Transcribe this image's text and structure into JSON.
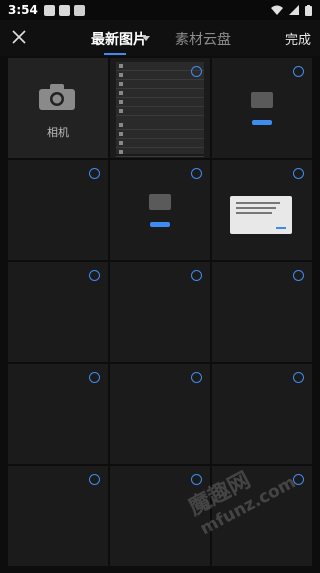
{
  "status_bar": {
    "time": "3:54"
  },
  "header": {
    "close_icon": "close-icon",
    "tabs": [
      {
        "label": "最新图片",
        "active": true
      },
      {
        "label": "素材云盘",
        "active": false
      }
    ],
    "done_label": "完成"
  },
  "grid": {
    "camera_label": "相机",
    "accent_color": "#3f8cf0"
  },
  "watermark": {
    "brand": "魔趣网",
    "url": "mfunz.com"
  }
}
